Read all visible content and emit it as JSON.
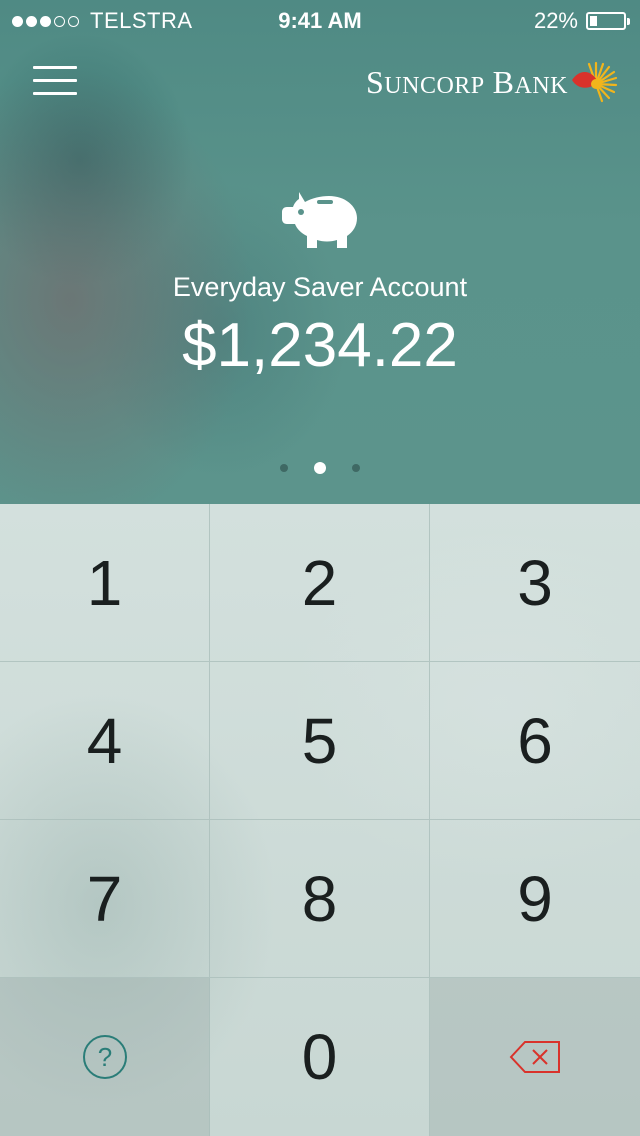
{
  "status_bar": {
    "signal_strength": "3 of 5",
    "carrier": "TELSTRA",
    "time": "9:41 AM",
    "battery_percent": "22%",
    "battery_level": 0.22
  },
  "header": {
    "menu_icon": "hamburger-menu-icon",
    "brand_name": "Suncorp Bank",
    "brand_colors": {
      "logo_yellow": "#f2b51c",
      "logo_red": "#d9322b"
    }
  },
  "account": {
    "icon": "piggy-bank-icon",
    "name": "Everyday Saver Account",
    "balance": "$1,234.22"
  },
  "pager": {
    "count": 3,
    "active_index": 1
  },
  "keypad": {
    "keys": [
      "1",
      "2",
      "3",
      "4",
      "5",
      "6",
      "7",
      "8",
      "9",
      "?",
      "0",
      "⌫"
    ],
    "help_icon": "question-mark-icon",
    "delete_icon": "backspace-icon",
    "colors": {
      "help": "#2a7d78",
      "delete": "#d9322b"
    }
  }
}
